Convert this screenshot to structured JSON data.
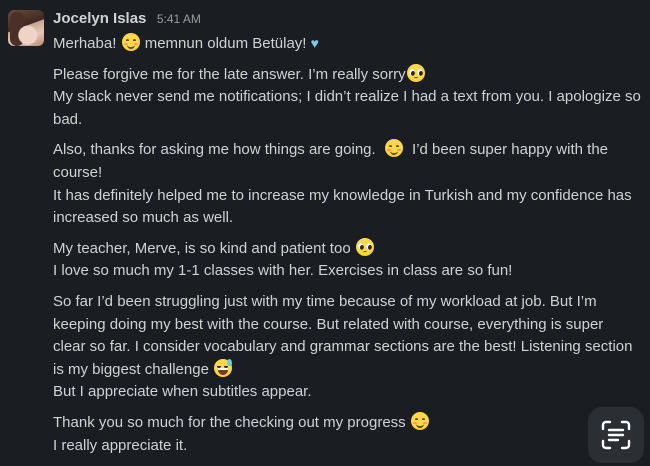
{
  "message": {
    "author": "Jocelyn Islas",
    "timestamp": "5:41 AM",
    "avatar_icon": "avatar-photo",
    "paragraphs": [
      {
        "lines": [
          {
            "parts": [
              "Merhaba! ",
              "",
              " memnun oldum Betülay! "
            ],
            "emojis": [
              "smiling-face",
              "light-blue-heart"
            ]
          }
        ]
      },
      {
        "lines": [
          {
            "text": "Please forgive me for the late answer. I’m really sorry",
            "emoji": "pleading-face"
          },
          {
            "text": "My slack never send me notifications; I didn’t realize I had a text from you. I apologize so"
          },
          {
            "text": "bad."
          }
        ]
      },
      {
        "lines": [
          {
            "text_a": "Also, thanks for asking me how things are going.",
            "text_b": "I’d been super happy with the",
            "emoji": "smiling-face"
          },
          {
            "text": "course!"
          },
          {
            "text": "It has definitely helped me to increase my knowledge in Turkish and my confidence has"
          },
          {
            "text": "increased so much as well."
          }
        ]
      },
      {
        "lines": [
          {
            "text": "My teacher, Merve, is so kind and patient too",
            "emoji": "pleading-face"
          },
          {
            "text": "I love so much my 1-1 classes with her. Exercises in class are so fun!"
          }
        ]
      },
      {
        "lines": [
          {
            "text": "So far I’d been struggling just with my time because of my workload at job. But I’m"
          },
          {
            "text": "keeping doing my best with the course. But related with course, everything is super"
          },
          {
            "text": "clear so far. I consider vocabulary and grammar sections are the best! Listening section"
          },
          {
            "text": "is my biggest challenge",
            "emoji": "grinning-sweat-face"
          },
          {
            "text": "But I appreciate when subtitles appear."
          }
        ]
      },
      {
        "lines": [
          {
            "text": "Thank you so much for the checking out my progress",
            "emoji": "smiling-face"
          },
          {
            "text": "I really appreciate it."
          }
        ]
      }
    ]
  },
  "overlay": {
    "scan_button_icon": "text-scan-icon"
  },
  "colors": {
    "background": "#1a1d21",
    "text": "#d1d2d3",
    "timestamp": "#9b9c9e",
    "heart": "#7cc7f0"
  }
}
